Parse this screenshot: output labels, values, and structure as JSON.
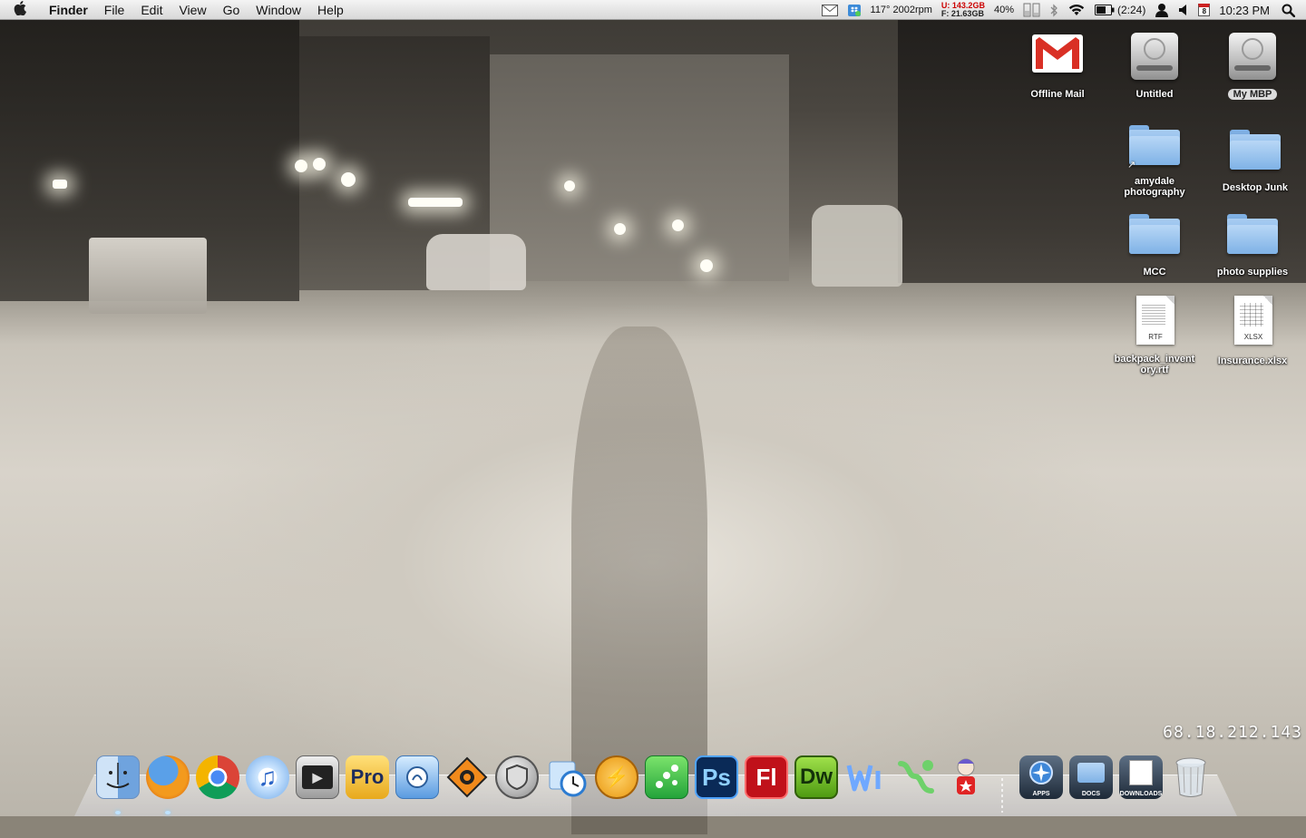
{
  "menubar": {
    "app_name": "Finder",
    "menus": [
      "File",
      "Edit",
      "View",
      "Go",
      "Window",
      "Help"
    ],
    "status": {
      "mail_icon": "mail-envelope-icon",
      "dropbox_icon": "dropbox-icon",
      "temperature_fan": "117° 2002rpm",
      "disk_used": "U: 143.2GB",
      "disk_free": "F: 21.63GB",
      "cpu_percent": "40%",
      "battery_time": "(2:24)",
      "calendar_day": "8",
      "clock": "10:23 PM"
    }
  },
  "desktop_icons": [
    {
      "label": "Offline Mail",
      "kind": "gmail"
    },
    {
      "label": "Untitled",
      "kind": "drive"
    },
    {
      "label": "My MBP",
      "kind": "drive",
      "selected": true
    },
    {
      "label": "amydale photography",
      "kind": "folder-alias"
    },
    {
      "label": "Desktop Junk",
      "kind": "folder"
    },
    {
      "label": "MCC",
      "kind": "folder"
    },
    {
      "label": "photo supplies",
      "kind": "folder"
    },
    {
      "label": "backpack_inventory.rtf",
      "kind": "doc",
      "ext": "RTF"
    },
    {
      "label": "Insurance.xlsx",
      "kind": "doc",
      "ext": "XLSX"
    }
  ],
  "ip_address": "68.18.212.143",
  "dock": {
    "apps": [
      {
        "name": "Finder",
        "icon": "finder-icon",
        "running": true
      },
      {
        "name": "Firefox",
        "icon": "firefox-icon",
        "running": true
      },
      {
        "name": "Google Chrome",
        "icon": "chrome-icon",
        "running": false
      },
      {
        "name": "iTunes",
        "icon": "itunes-icon",
        "running": false
      },
      {
        "name": "Front Row",
        "icon": "media-player-icon",
        "running": false
      },
      {
        "name": "Pro",
        "icon": "pro-icon",
        "text": "Pro",
        "running": false
      },
      {
        "name": "Preview",
        "icon": "preview-icon",
        "running": false
      },
      {
        "name": "Reason",
        "icon": "reason-icon",
        "running": false
      },
      {
        "name": "Shield",
        "icon": "shield-app-icon",
        "running": false
      },
      {
        "name": "Time Machine",
        "icon": "clock-bag-icon",
        "running": false
      },
      {
        "name": "Stuffit",
        "icon": "stuffit-icon",
        "running": false
      },
      {
        "name": "Game",
        "icon": "green-dots-icon",
        "running": false
      },
      {
        "name": "Photoshop",
        "icon": "photoshop-icon",
        "text": "Ps",
        "running": false
      },
      {
        "name": "Flash",
        "icon": "flash-icon",
        "text": "Fl",
        "running": false
      },
      {
        "name": "Dreamweaver",
        "icon": "dreamweaver-icon",
        "text": "Dw",
        "running": false
      },
      {
        "name": "Writer",
        "icon": "wi-icon",
        "running": false
      },
      {
        "name": "Network",
        "icon": "network-icon",
        "running": false
      },
      {
        "name": "Stamp",
        "icon": "stamp-doll-icon",
        "running": false
      }
    ],
    "stacks": [
      {
        "name": "Applications",
        "label": "APPS"
      },
      {
        "name": "Documents",
        "label": "DOCS"
      },
      {
        "name": "Downloads",
        "label": "DOWNLOADS"
      }
    ],
    "trash": {
      "name": "Trash",
      "icon": "trash-icon"
    }
  }
}
